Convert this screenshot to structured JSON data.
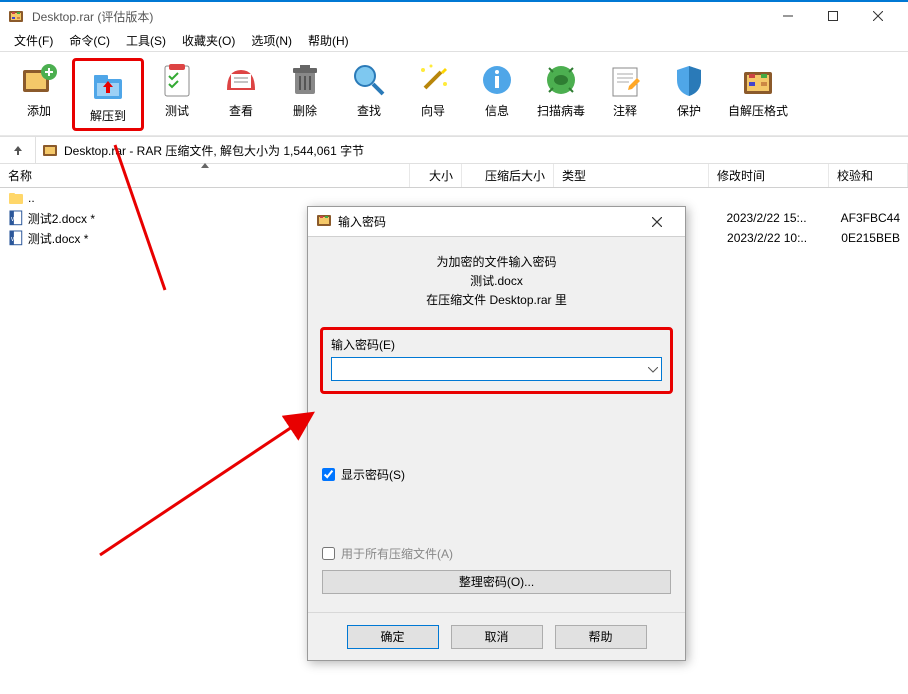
{
  "window": {
    "title": "Desktop.rar (评估版本)"
  },
  "win_controls": {
    "min": "—",
    "max": "☐",
    "close": "✕"
  },
  "menu": {
    "items": [
      "文件(F)",
      "命令(C)",
      "工具(S)",
      "收藏夹(O)",
      "选项(N)",
      "帮助(H)"
    ]
  },
  "toolbar": {
    "add": "添加",
    "extract": "解压到",
    "test": "测试",
    "view": "查看",
    "delete": "删除",
    "find": "查找",
    "wizard": "向导",
    "info": "信息",
    "scan": "扫描病毒",
    "comment": "注释",
    "protect": "保护",
    "sfx": "自解压格式"
  },
  "address": {
    "path": "Desktop.rar - RAR 压缩文件, 解包大小为 1,544,061 字节"
  },
  "columns": {
    "name": "名称",
    "size": "大小",
    "packed": "压缩后大小",
    "type": "类型",
    "mtime": "修改时间",
    "crc": "校验和"
  },
  "files": [
    {
      "name": "..",
      "icon": "folder-up",
      "mtime": "",
      "crc": ""
    },
    {
      "name": "测试2.docx *",
      "icon": "docx",
      "mtime": "2023/2/22 15:..",
      "crc": "AF3FBC44"
    },
    {
      "name": "测试.docx *",
      "icon": "docx",
      "mtime": "2023/2/22 10:..",
      "crc": "0E215BEB"
    }
  ],
  "dialog": {
    "title": "输入密码",
    "msg_line1": "为加密的文件输入密码",
    "msg_line2": "测试.docx",
    "msg_line3": "在压缩文件 Desktop.rar 里",
    "pw_label": "输入密码(E)",
    "pw_value": "",
    "show_pw": "显示密码(S)",
    "show_pw_checked": true,
    "use_all": "用于所有压缩文件(A)",
    "use_all_checked": false,
    "organize": "整理密码(O)...",
    "ok": "确定",
    "cancel": "取消",
    "help": "帮助"
  }
}
